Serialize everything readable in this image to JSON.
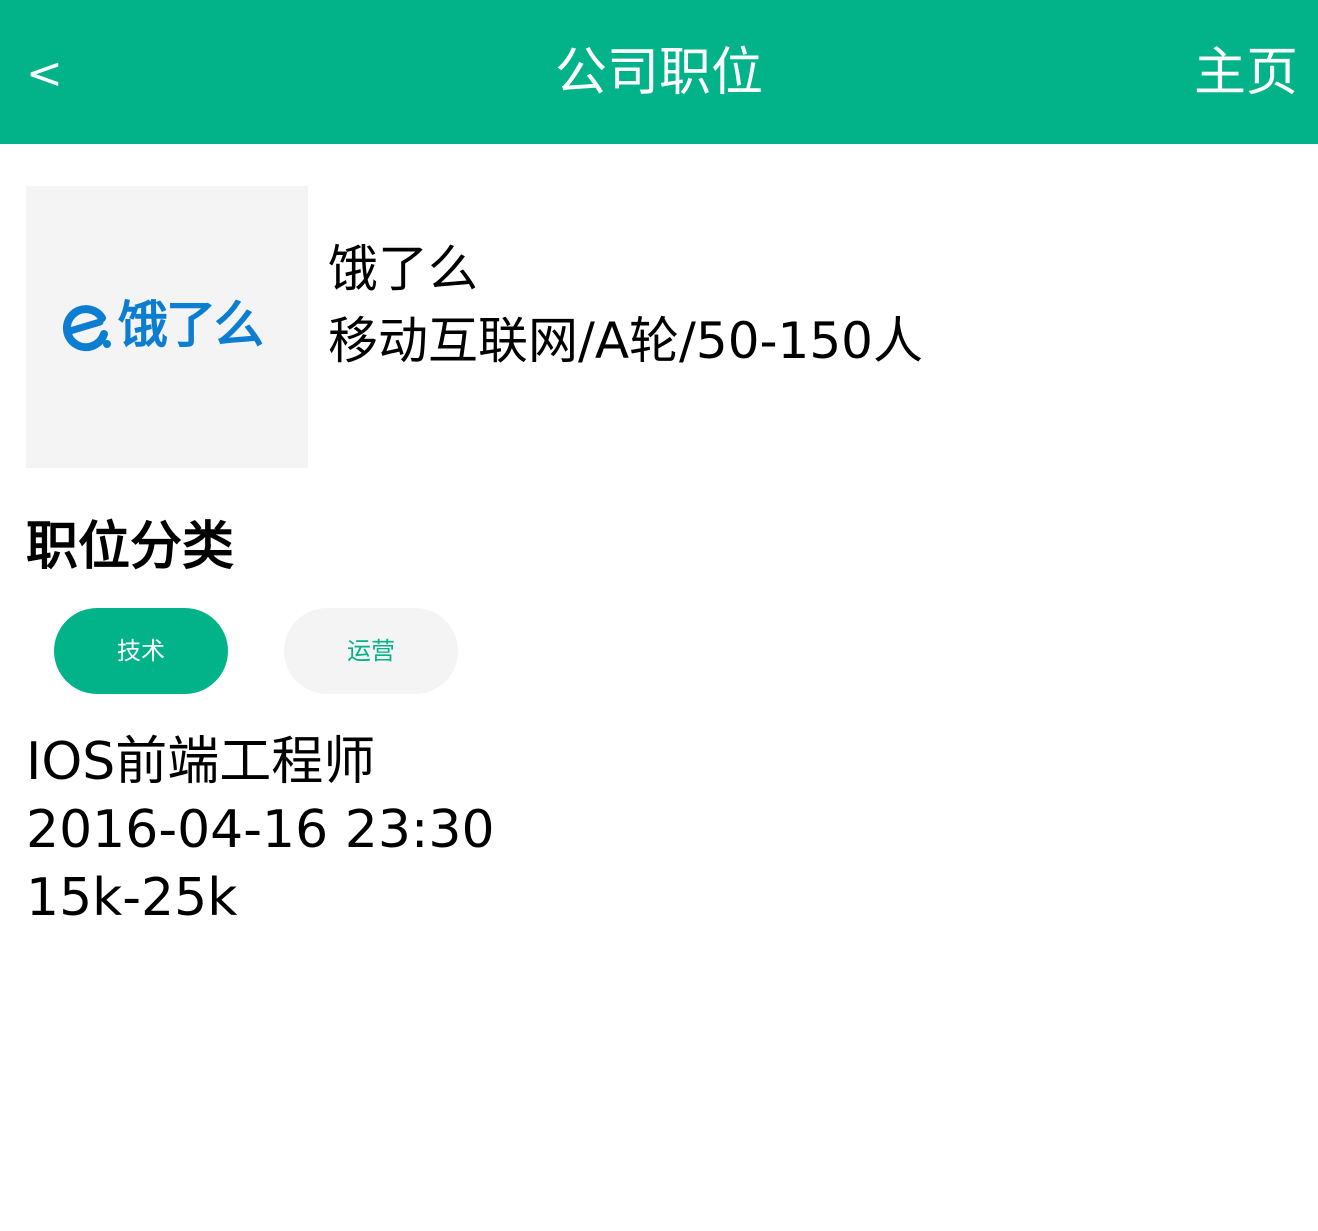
{
  "header": {
    "back_label": "<",
    "title": "公司职位",
    "home_label": "主页",
    "background_color": "#02b38a"
  },
  "company": {
    "logo_text": "饿了么",
    "logo_icon": "eleme-e-icon",
    "logo_color": "#0c7ed1",
    "name": "饿了么",
    "meta": "移动互联网/A轮/50-150人"
  },
  "categories": {
    "title": "职位分类",
    "items": [
      {
        "label": "技术",
        "active": true
      },
      {
        "label": "运营",
        "active": false
      }
    ]
  },
  "jobs": [
    {
      "title": "IOS前端工程师",
      "date": "2016-04-16 23:30",
      "salary": "15k-25k"
    }
  ]
}
